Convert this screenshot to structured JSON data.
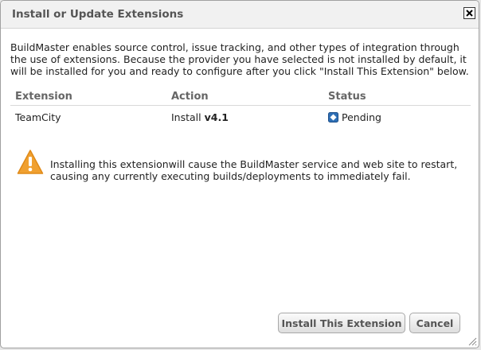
{
  "dialog": {
    "title": "Install or Update Extensions",
    "intro_text": "BuildMaster enables source control, issue tracking, and other types of integration through the use of extensions. Because the provider you have selected is not installed by default, it will be installed for you and ready to configure after you click \"Install This Extension\" below."
  },
  "table": {
    "headers": [
      "Extension",
      "Action",
      "Status"
    ],
    "rows": [
      {
        "extension": "TeamCity",
        "action_prefix": "Install",
        "version": "v4.1",
        "status": "Pending"
      }
    ]
  },
  "warning": {
    "text": "Installing this extensionwill cause the BuildMaster service and web site to restart, causing any currently executing builds/deployments to immediately fail."
  },
  "buttons": {
    "install": "Install This Extension",
    "cancel": "Cancel"
  },
  "icons": {
    "close": "close-icon",
    "status": "pending-icon",
    "warning": "warning-icon",
    "resize": "resize-grip-icon"
  },
  "colors": {
    "warning": "#f0a030",
    "status_blue": "#2e6fb5"
  }
}
